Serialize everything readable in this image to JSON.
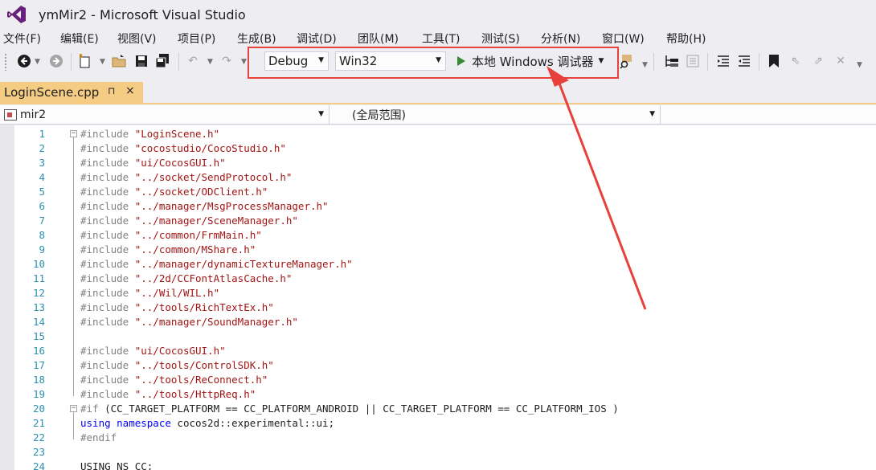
{
  "window": {
    "title": "ymMir2 - Microsoft Visual Studio"
  },
  "menu": [
    "文件(F)",
    "编辑(E)",
    "视图(V)",
    "项目(P)",
    "生成(B)",
    "调试(D)",
    "团队(M)",
    "工具(T)",
    "测试(S)",
    "分析(N)",
    "窗口(W)",
    "帮助(H)"
  ],
  "toolbar": {
    "config": "Debug",
    "platform": "Win32",
    "run_label": "本地 Windows 调试器"
  },
  "tab": {
    "label": "LoginScene.cpp",
    "pin": "⊓",
    "close": "×"
  },
  "navbar": {
    "project": "mir2",
    "scope": "(全局范围)"
  },
  "code": [
    {
      "n": "1",
      "parts": [
        [
          "pp",
          "#include "
        ],
        [
          "str",
          "\"LoginScene.h\""
        ]
      ]
    },
    {
      "n": "2",
      "parts": [
        [
          "pp",
          "#include "
        ],
        [
          "str",
          "\"cocostudio/CocoStudio.h\""
        ]
      ]
    },
    {
      "n": "3",
      "parts": [
        [
          "pp",
          "#include "
        ],
        [
          "str",
          "\"ui/CocosGUI.h\""
        ]
      ]
    },
    {
      "n": "4",
      "parts": [
        [
          "pp",
          "#include "
        ],
        [
          "str",
          "\"../socket/SendProtocol.h\""
        ]
      ]
    },
    {
      "n": "5",
      "parts": [
        [
          "pp",
          "#include "
        ],
        [
          "str",
          "\"../socket/ODClient.h\""
        ]
      ]
    },
    {
      "n": "6",
      "parts": [
        [
          "pp",
          "#include "
        ],
        [
          "str",
          "\"../manager/MsgProcessManager.h\""
        ]
      ]
    },
    {
      "n": "7",
      "parts": [
        [
          "pp",
          "#include "
        ],
        [
          "str",
          "\"../manager/SceneManager.h\""
        ]
      ]
    },
    {
      "n": "8",
      "parts": [
        [
          "pp",
          "#include "
        ],
        [
          "str",
          "\"../common/FrmMain.h\""
        ]
      ]
    },
    {
      "n": "9",
      "parts": [
        [
          "pp",
          "#include "
        ],
        [
          "str",
          "\"../common/MShare.h\""
        ]
      ]
    },
    {
      "n": "10",
      "parts": [
        [
          "pp",
          "#include "
        ],
        [
          "str",
          "\"../manager/dynamicTextureManager.h\""
        ]
      ]
    },
    {
      "n": "11",
      "parts": [
        [
          "pp",
          "#include "
        ],
        [
          "str",
          "\"../2d/CCFontAtlasCache.h\""
        ]
      ]
    },
    {
      "n": "12",
      "parts": [
        [
          "pp",
          "#include "
        ],
        [
          "str",
          "\"../Wil/WIL.h\""
        ]
      ]
    },
    {
      "n": "13",
      "parts": [
        [
          "pp",
          "#include "
        ],
        [
          "str",
          "\"../tools/RichTextEx.h\""
        ]
      ]
    },
    {
      "n": "14",
      "parts": [
        [
          "pp",
          "#include "
        ],
        [
          "str",
          "\"../manager/SoundManager.h\""
        ]
      ]
    },
    {
      "n": "15",
      "parts": []
    },
    {
      "n": "16",
      "parts": [
        [
          "pp",
          "#include "
        ],
        [
          "str",
          "\"ui/CocosGUI.h\""
        ]
      ]
    },
    {
      "n": "17",
      "parts": [
        [
          "pp",
          "#include "
        ],
        [
          "str",
          "\"../tools/ControlSDK.h\""
        ]
      ]
    },
    {
      "n": "18",
      "parts": [
        [
          "pp",
          "#include "
        ],
        [
          "str",
          "\"../tools/ReConnect.h\""
        ]
      ]
    },
    {
      "n": "19",
      "parts": [
        [
          "pp",
          "#include "
        ],
        [
          "str",
          "\"../tools/HttpReq.h\""
        ]
      ]
    },
    {
      "n": "20",
      "parts": [
        [
          "pp",
          "#if "
        ],
        [
          "normal",
          "(CC_TARGET_PLATFORM == CC_PLATFORM_ANDROID || CC_TARGET_PLATFORM == CC_PLATFORM_IOS )"
        ]
      ]
    },
    {
      "n": "21",
      "parts": [
        [
          "kw",
          "using namespace "
        ],
        [
          "normal",
          "cocos2d::experimental::ui;"
        ]
      ]
    },
    {
      "n": "22",
      "parts": [
        [
          "pp",
          "#endif"
        ]
      ]
    },
    {
      "n": "23",
      "parts": []
    },
    {
      "n": "24",
      "parts": [
        [
          "normal",
          "USING_NS_CC;"
        ]
      ]
    }
  ],
  "colors": {
    "highlight": "#e8413b",
    "tab_active": "#f5cc84",
    "line_number": "#2b91af",
    "string": "#a31515",
    "keyword": "#0000ff",
    "run_green": "#388a34"
  }
}
